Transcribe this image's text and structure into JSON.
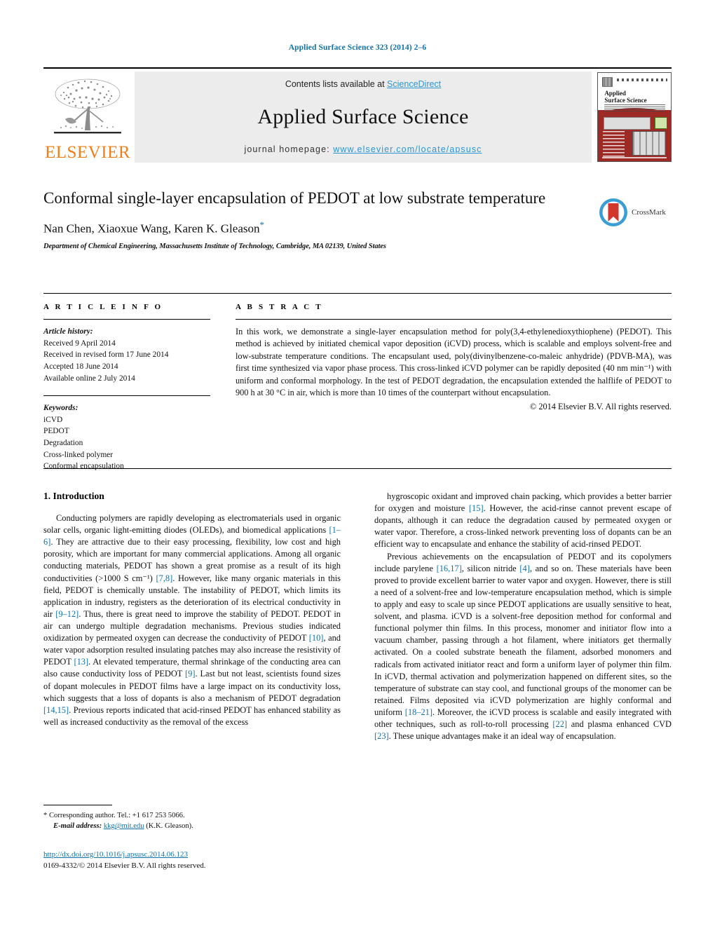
{
  "running_head": "Applied Surface Science 323 (2014) 2–6",
  "masthead": {
    "contents_prefix": "Contents lists available at ",
    "sciencedirect": "ScienceDirect",
    "journal_title": "Applied Surface Science",
    "homepage_prefix": "journal homepage: ",
    "homepage_url": "www.elsevier.com/locate/apsusc",
    "publisher": "ELSEVIER",
    "cover_title_line1": "Applied",
    "cover_title_line2": "Surface Science"
  },
  "title_block": {
    "title": "Conformal single-layer encapsulation of PEDOT at low substrate temperature",
    "authors": "Nan Chen, Xiaoxue Wang, Karen K. Gleason",
    "author_marker": "*",
    "affiliation": "Department of Chemical Engineering, Massachusetts Institute of Technology, Cambridge, MA 02139, United States",
    "crossmark_label": "CrossMark"
  },
  "article_info": {
    "heading": "A R T I C L E    I N F O",
    "history_label": "Article history:",
    "history": [
      "Received 9 April 2014",
      "Received in revised form 17 June 2014",
      "Accepted 18 June 2014",
      "Available online 2 July 2014"
    ],
    "keywords_label": "Keywords:",
    "keywords": [
      "iCVD",
      "PEDOT",
      "Degradation",
      "Cross-linked polymer",
      "Conformal encapsulation"
    ]
  },
  "abstract": {
    "heading": "A B S T R A C T",
    "text": "In this work, we demonstrate a single-layer encapsulation method for poly(3,4-ethylenedioxythiophene) (PEDOT). This method is achieved by initiated chemical vapor deposition (iCVD) process, which is scalable and employs solvent-free and low-substrate temperature conditions. The encapsulant used, poly(divinylbenzene-co-maleic anhydride) (PDVB-MA), was first time synthesized via vapor phase process. This cross-linked iCVD polymer can be rapidly deposited (40 nm min⁻¹) with uniform and conformal morphology. In the test of PEDOT degradation, the encapsulation extended the halflife of PEDOT to 900 h at 30 °C in air, which is more than 10 times of the counterpart without encapsulation.",
    "copyright": "© 2014 Elsevier B.V. All rights reserved."
  },
  "body": {
    "section_number_title": "1.  Introduction",
    "left_paragraphs": [
      "Conducting polymers are rapidly developing as electromaterials used in organic solar cells, organic light-emitting diodes (OLEDs), and biomedical applications [1–6]. They are attractive due to their easy processing, flexibility, low cost and high porosity, which are important for many commercial applications. Among all organic conducting materials, PEDOT has shown a great promise as a result of its high conductivities (>1000 S cm⁻¹) [7,8]. However, like many organic materials in this field, PEDOT is chemically unstable. The instability of PEDOT, which limits its application in industry, registers as the deterioration of its electrical conductivity in air [9–12]. Thus, there is great need to improve the stability of PEDOT. PEDOT in air can undergo multiple degradation mechanisms. Previous studies indicated oxidization by permeated oxygen can decrease the conductivity of PEDOT [10], and water vapor adsorption resulted insulating patches may also increase the resistivity of PEDOT [13]. At elevated temperature, thermal shrinkage of the conducting area can also cause conductivity loss of PEDOT [9]. Last but not least, scientists found sizes of dopant molecules in PEDOT films have a large impact on its conductivity loss, which suggests that a loss of dopants is also a mechanism of PEDOT degradation [14,15]. Previous reports indicated that acid-rinsed PEDOT has enhanced stability as well as increased conductivity as the removal of the excess"
    ],
    "right_paragraphs": [
      "hygroscopic oxidant and improved chain packing, which provides a better barrier for oxygen and moisture [15]. However, the acid-rinse cannot prevent escape of dopants, although it can reduce the degradation caused by permeated oxygen or water vapor. Therefore, a cross-linked network preventing loss of dopants can be an efficient way to encapsulate and enhance the stability of acid-rinsed PEDOT.",
      "Previous achievements on the encapsulation of PEDOT and its copolymers include parylene [16,17], silicon nitride [4], and so on. These materials have been proved to provide excellent barrier to water vapor and oxygen. However, there is still a need of a solvent-free and low-temperature encapsulation method, which is simple to apply and easy to scale up since PEDOT applications are usually sensitive to heat, solvent, and plasma. iCVD is a solvent-free deposition method for conformal and functional polymer thin films. In this process, monomer and initiator flow into a vacuum chamber, passing through a hot filament, where initiators get thermally activated. On a cooled substrate beneath the filament, adsorbed monomers and radicals from activated initiator react and form a uniform layer of polymer thin film. In iCVD, thermal activation and polymerization happened on different sites, so the temperature of substrate can stay cool, and functional groups of the monomer can be retained. Films deposited via iCVD polymerization are highly conformal and uniform [18–21]. Moreover, the iCVD process is scalable and easily integrated with other techniques, such as roll-to-roll processing [22] and plasma enhanced CVD [23]. These unique advantages make it an ideal way of encapsulation."
    ]
  },
  "footnote": {
    "marker": "*",
    "corresponding": "Corresponding author. Tel.: +1 617 253 5066.",
    "email_label": "E-mail address:",
    "email": "kkg@mit.edu",
    "email_suffix": "(K.K. Gleason)."
  },
  "doi": {
    "url": "http://dx.doi.org/10.1016/j.apsusc.2014.06.123",
    "issn_line": "0169-4332/© 2014 Elsevier B.V. All rights reserved."
  },
  "colors": {
    "link_blue": "#1072a8",
    "sd_blue": "#2b95d6",
    "elsevier_orange": "#F07F1A",
    "masthead_gray": "#ececec"
  }
}
